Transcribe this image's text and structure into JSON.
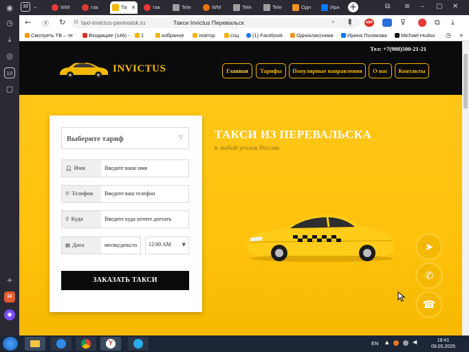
{
  "browser": {
    "tab_count": "10",
    "tabs": [
      {
        "label": "WM",
        "color": "#e53935"
      },
      {
        "label": "так",
        "color": "#e53935"
      },
      {
        "label": "Та",
        "color": "#f5b800"
      },
      {
        "label": "так",
        "color": "#e53935"
      },
      {
        "label": "Tele",
        "color": "#9e9e9e"
      },
      {
        "label": "WM",
        "color": "#e8710a"
      },
      {
        "label": "Tele",
        "color": "#9e9e9e"
      },
      {
        "label": "Tele",
        "color": "#9e9e9e"
      },
      {
        "label": "Одн",
        "color": "#f7931e"
      },
      {
        "label": "Ири",
        "color": "#0077ff"
      }
    ],
    "url": "taxi-invictus-perevalsk.ru",
    "page_title": "Такси Invictus Перевальск",
    "bookmarks": [
      {
        "label": "Смотреть ТВ – те",
        "color": "#ff9800"
      },
      {
        "label": "Входящие (146) -",
        "color": "#d93025"
      },
      {
        "label": "1",
        "color": "#f4b400"
      },
      {
        "label": "избраное",
        "color": "#f4b400"
      },
      {
        "label": "повтор",
        "color": "#f4b400"
      },
      {
        "label": "соц",
        "color": "#f4b400"
      },
      {
        "label": "(1) Facebook",
        "color": "#1877f2"
      },
      {
        "label": "Одноклассники",
        "color": "#f7931e"
      },
      {
        "label": "Ирина Полякова",
        "color": "#0077ff"
      },
      {
        "label": "Michael Hudso",
        "color": "#111111"
      }
    ]
  },
  "site": {
    "phone": "Тел: +7(908)500-21-21",
    "logo": "INVICTUS",
    "menu": [
      "Главная",
      "Тарифы",
      "Популярные направления",
      "О нас",
      "Контакты"
    ],
    "form": {
      "tariff_placeholder": "Выберите тариф",
      "name_label": "Имя",
      "name_placeholder": "Введите ваше имя",
      "phone_label": "Телефон",
      "phone_placeholder": "Введите ваш телефон",
      "dest_label": "Куда",
      "dest_placeholder": "Введите куда хотите доехать",
      "date_label": "Дата",
      "date_placeholder": "месяц/день/го",
      "time_value": "12:00 AM",
      "submit": "ЗАКАЗАТЬ ТАКСИ"
    },
    "hero_title": "ТАКСИ ИЗ ПЕРЕВАЛЬСКА",
    "hero_subtitle": "в любой уголок России",
    "accent_color": "#f5b800"
  },
  "taskbar": {
    "lang": "EN",
    "time": "18:41",
    "date": "09.05.2025"
  }
}
